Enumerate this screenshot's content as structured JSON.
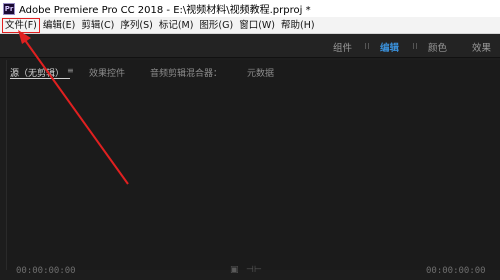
{
  "window": {
    "title": "Adobe Premiere Pro CC 2018 - E:\\视频材料\\视频教程.prproj *",
    "app_icon_text": "Pr"
  },
  "menubar": {
    "items": [
      {
        "label": "文件(F)"
      },
      {
        "label": "编辑(E)"
      },
      {
        "label": "剪辑(C)"
      },
      {
        "label": "序列(S)"
      },
      {
        "label": "标记(M)"
      },
      {
        "label": "图形(G)"
      },
      {
        "label": "窗口(W)"
      },
      {
        "label": "帮助(H)"
      }
    ]
  },
  "workspaces": {
    "tabs": [
      {
        "label": "组件"
      },
      {
        "label": "编辑"
      },
      {
        "label": "颜色"
      },
      {
        "label": "效果"
      }
    ],
    "active": "编辑"
  },
  "panel": {
    "tabs": [
      {
        "label": "源（无剪辑）"
      },
      {
        "label": "效果控件"
      },
      {
        "label": "音频剪辑混合器："
      },
      {
        "label": "元数据"
      }
    ],
    "menu_glyph": "≡",
    "timecode_left": "00:00:00:00",
    "timecode_right": "00:00:00:00"
  },
  "annotation": {
    "color": "#e02020"
  }
}
